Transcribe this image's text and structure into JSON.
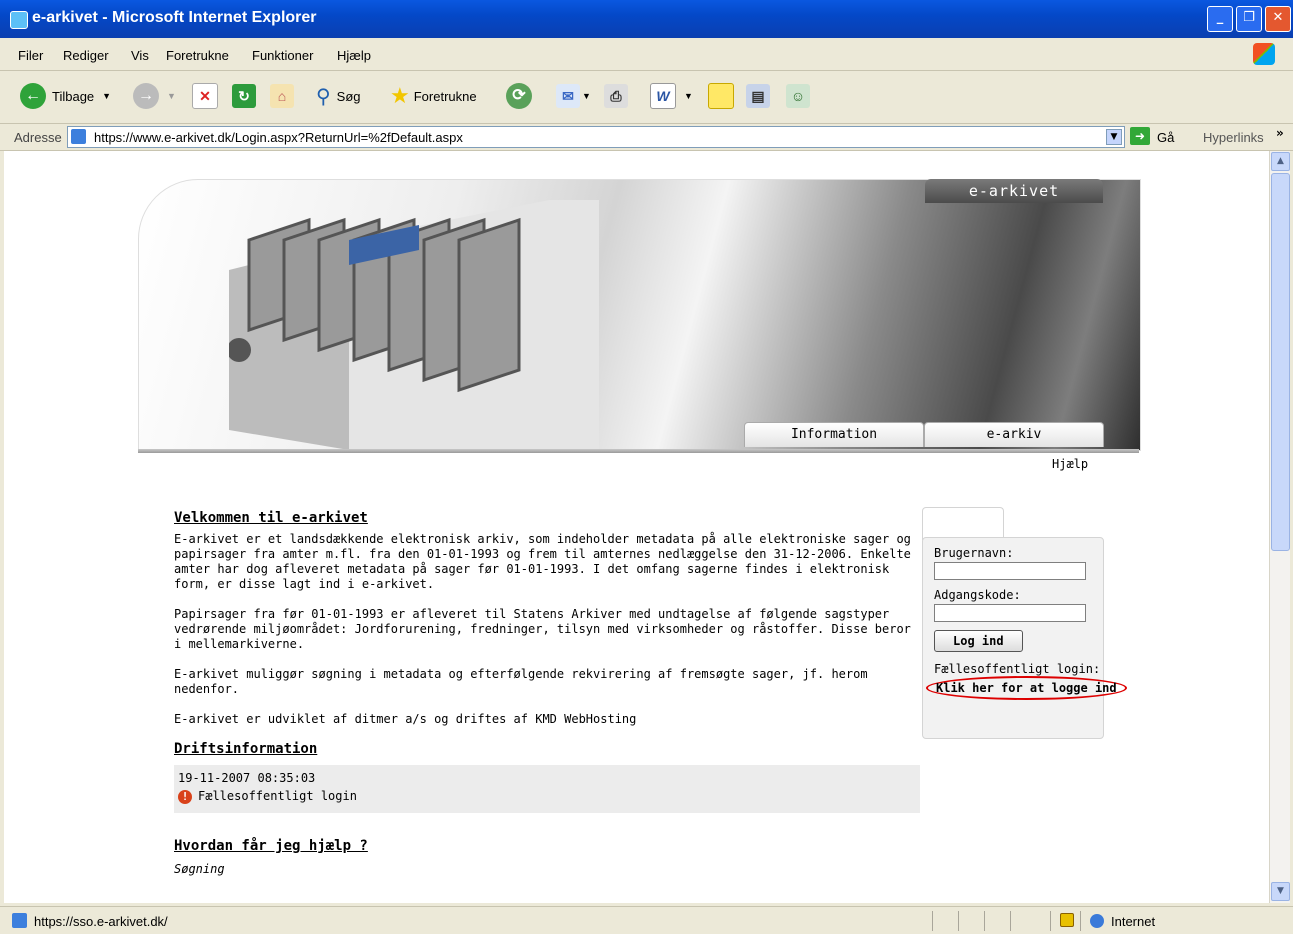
{
  "window": {
    "title": "e-arkivet - Microsoft Internet Explorer",
    "min": "_",
    "max": "❐",
    "close": "✕"
  },
  "menu": [
    "Filer",
    "Rediger",
    "Vis",
    "Foretrukne",
    "Funktioner",
    "Hjælp"
  ],
  "toolbar": {
    "back": "Tilbage",
    "search": "Søg",
    "favorites": "Foretrukne"
  },
  "address": {
    "label": "Adresse",
    "url": "https://www.e-arkivet.dk/Login.aspx?ReturnUrl=%2fDefault.aspx",
    "go": "Gå",
    "links": "Hyperlinks"
  },
  "site": {
    "brand_tab": "e-arkivet",
    "nav": [
      "Information",
      "e-arkiv"
    ],
    "help": "Hjælp",
    "welcome_title": "Velkommen til e-arkivet",
    "welcome_p1": "E-arkivet er et landsdækkende elektronisk arkiv, som indeholder metadata på alle elektroniske sager og papirsager fra amter m.fl. fra den 01-01-1993 og frem til amternes nedlæggelse den 31-12-2006. Enkelte amter har dog afleveret metadata på sager før 01-01-1993. I det omfang sagerne findes i elektronisk form, er disse lagt ind i e-arkivet.",
    "welcome_p2": "Papirsager fra før 01-01-1993 er afleveret til Statens Arkiver med undtagelse af følgende sagstyper vedrørende miljøområdet: Jordforurening, fredninger, tilsyn med virksomheder og råstoffer. Disse beror i mellemarkiverne.",
    "welcome_p3": "E-arkivet muliggør søgning i metadata og efterfølgende rekvirering af fremsøgte sager, jf. herom nedenfor.",
    "welcome_p4": "E-arkivet er udviklet af ditmer a/s og driftes af KMD WebHosting",
    "drift_title": "Driftsinformation",
    "drift_date": "19-11-2007 08:35:03",
    "drift_item": "Fællesoffentligt login",
    "help_title": "Hvordan får jeg hjælp ?",
    "help_sub": "Søgning"
  },
  "login": {
    "username_label": "Brugernavn:",
    "password_label": "Adgangskode:",
    "button": "Log ind",
    "sso_label": "Fællesoffentligt login:",
    "sso_link": "Klik her for at logge ind"
  },
  "status": {
    "text": "https://sso.e-arkivet.dk/",
    "zone": "Internet"
  }
}
